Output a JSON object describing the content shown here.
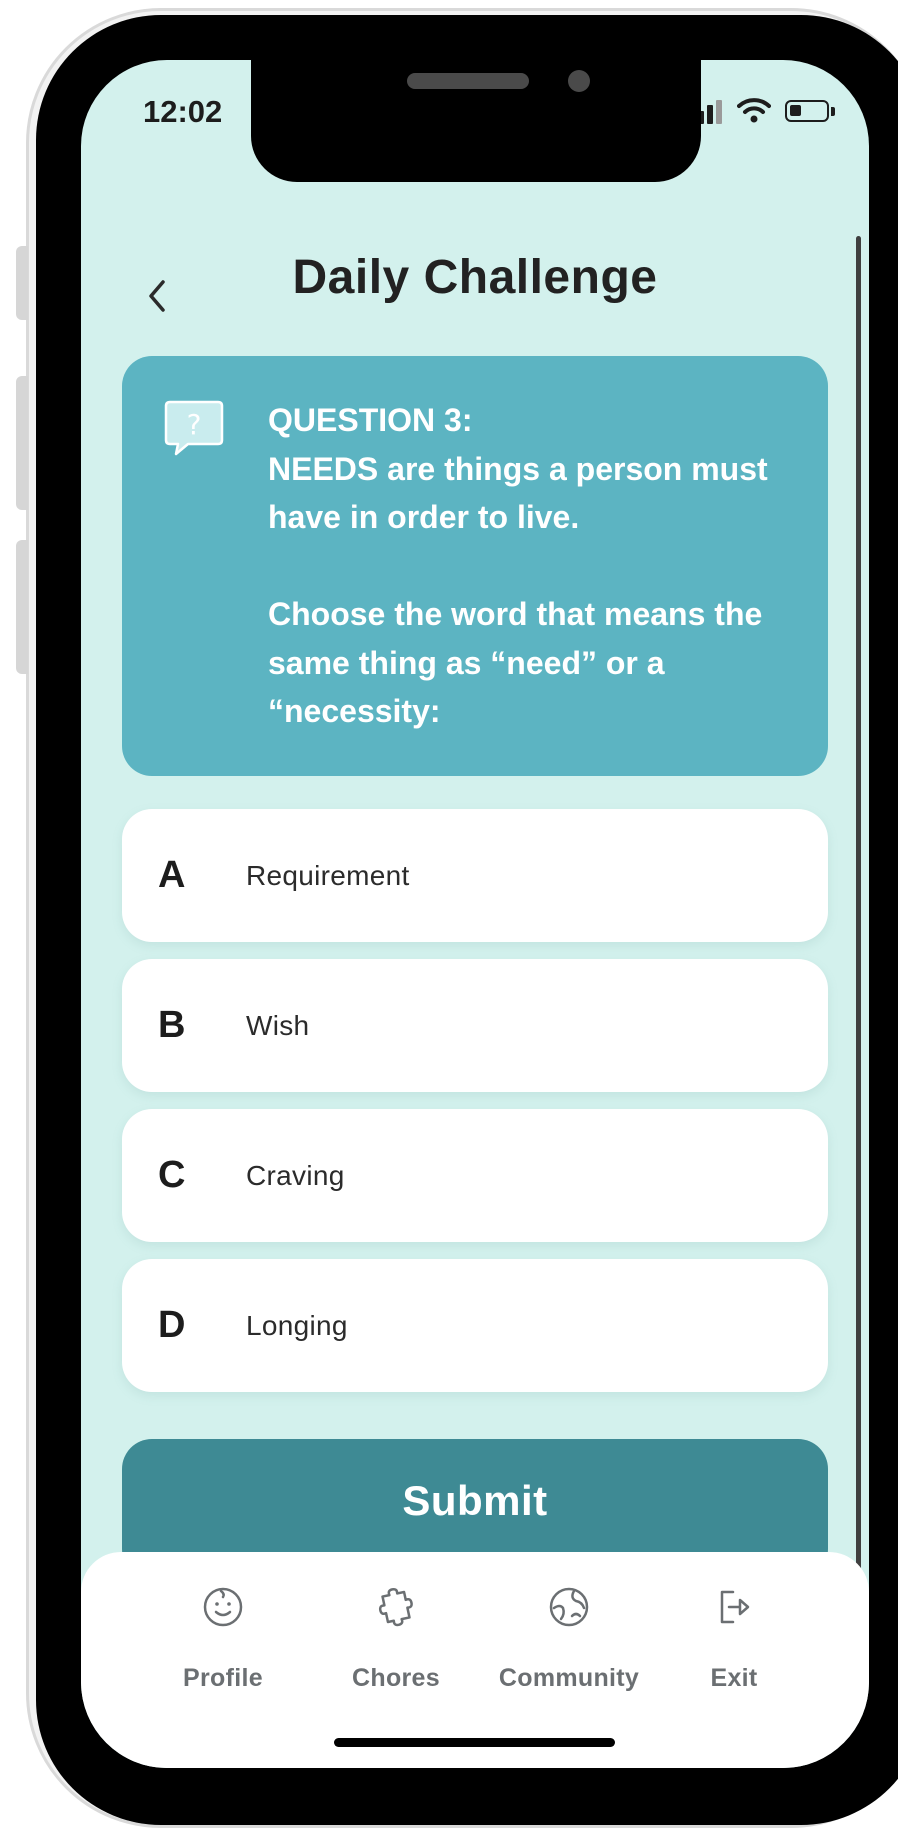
{
  "status_bar": {
    "time": "12:02",
    "icons": [
      "signal-icon",
      "wifi-icon",
      "battery-icon"
    ]
  },
  "header": {
    "back_icon": "chevron-left-icon",
    "title": "Daily Challenge"
  },
  "question": {
    "icon": "question-bubble-icon",
    "heading": "QUESTION 3:",
    "statement": "NEEDS are things a person must have in order to live.",
    "prompt": "Choose the word that means the same thing as “need” or a “necessity:"
  },
  "options": [
    {
      "letter": "A",
      "text": "Requirement"
    },
    {
      "letter": "B",
      "text": "Wish"
    },
    {
      "letter": "C",
      "text": "Craving"
    },
    {
      "letter": "D",
      "text": "Longing"
    }
  ],
  "submit_label": "Submit",
  "tabbar": {
    "items": [
      {
        "label": "Profile",
        "icon": "smiley-face-icon"
      },
      {
        "label": "Chores",
        "icon": "puzzle-piece-icon"
      },
      {
        "label": "Community",
        "icon": "globe-icon"
      },
      {
        "label": "Exit",
        "icon": "exit-icon"
      }
    ]
  },
  "colors": {
    "background": "#d3f1ed",
    "question_card": "#5cb4c2",
    "submit": "#3e8a94",
    "tab_label": "#6b6f72"
  }
}
